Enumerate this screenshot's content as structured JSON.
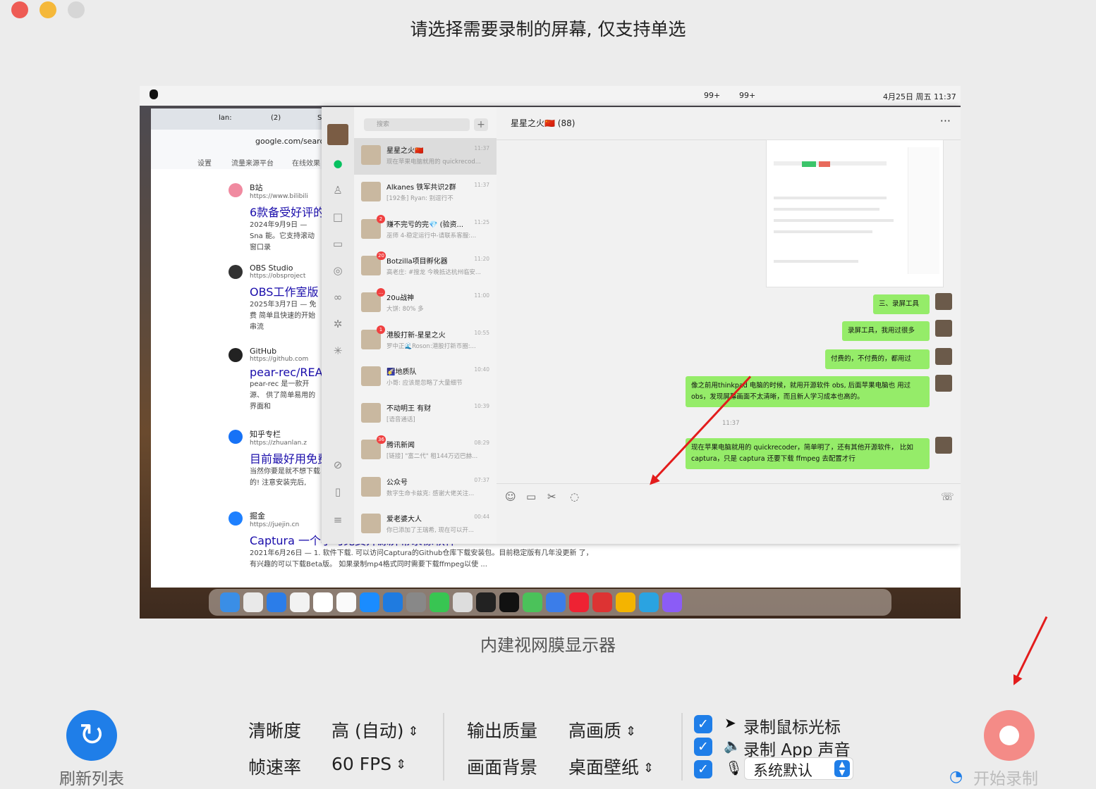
{
  "window": {
    "title": "请选择需要录制的屏幕, 仅支持单选",
    "close_color": "#ee5b54",
    "minimize_color": "#f5b83a",
    "zoom_color": "#d6d6d6"
  },
  "screen": {
    "name": "内建视网膜显示器",
    "menubar": {
      "datetime": "4月25日 周五 11:37",
      "wechat_badge_1": "99+",
      "wechat_badge_2": "99+"
    },
    "browser": {
      "tabs": [
        "lan:",
        "(2)",
        "S"
      ],
      "address": "google.com/search",
      "bookmarks": [
        "设置",
        "流量来源平台",
        "在线效果"
      ],
      "results": [
        {
          "site": "B站",
          "url": "https://www.bilibili",
          "title": "6款备受好评的",
          "snippet": "2024年9月9日 — Sna 能。它支持滚动窗口录"
        },
        {
          "site": "OBS Studio",
          "url": "https://obsproject",
          "title": "OBS工作室版",
          "snippet": "2025年3月7日 — 免费 简单且快速的开始串流"
        },
        {
          "site": "GitHub",
          "url": "https://github.com",
          "title": "pear-rec/READ",
          "snippet": "pear-rec 是一款开源、 供了简单易用的界面和"
        },
        {
          "site": "知乎专栏",
          "url": "https://zhuanlan.z",
          "title": "目前最好用免费",
          "snippet": "当然你要是就不想下载 的! 注意安装完后,"
        },
        {
          "site": "掘金",
          "url": "https://juejin.cn",
          "title": "Captura 一个小巧免费开源屏幕录像软件",
          "snippet": "2021年6月26日 — 1. 软件下载. 可以访问Captura的Github仓库下载安装包。目前稳定版有几年没更新 了，有兴趣的可以下载Beta版。 如果录制mp4格式同时需要下载ffmpeg以使 ..."
        }
      ]
    },
    "wechat": {
      "search_placeholder": "搜索",
      "chat_title": "星星之火🇨🇳 (88)",
      "conversations": [
        {
          "name": "星星之火🇨🇳",
          "preview": "现在苹果电脑就用的 quickrecod...",
          "time": "11:37",
          "badge": ""
        },
        {
          "name": "Alkanes 铁军共识2群",
          "preview": "[192条] Ryan: 别逗行不",
          "time": "11:37",
          "badge": ""
        },
        {
          "name": "赚不完亏的完💎 (验资...",
          "preview": "巫师 4-稳定运行中-请联系客服:...",
          "time": "11:25",
          "badge": "2"
        },
        {
          "name": "Botzilla项目孵化器",
          "preview": "高老庄: #搜龙 今晚抵达杭州临安...",
          "time": "11:20",
          "badge": "20"
        },
        {
          "name": "20u战神",
          "preview": "大饼: 80% 多",
          "time": "11:00",
          "badge": "..."
        },
        {
          "name": "港股打新-星星之火",
          "preview": "罗中正🌊Roson:港股打新币圈:...",
          "time": "10:55",
          "badge": "1"
        },
        {
          "name": "🌠地质队",
          "preview": "小哥: 应该是忽略了大量细节",
          "time": "10:40",
          "badge": ""
        },
        {
          "name": "不动明王 有财",
          "preview": "[语音通话]",
          "time": "10:39",
          "badge": ""
        },
        {
          "name": "腾讯新闻",
          "preview": "[链接] \"富二代\" 租144万迈巴赫...",
          "time": "08:29",
          "badge": "36"
        },
        {
          "name": "公众号",
          "preview": "数字生命卡兹克: 感谢大佬关注...",
          "time": "07:37",
          "badge": ""
        },
        {
          "name": "爱老婆大人",
          "preview": "你已添加了王瑞希, 现在可以开...",
          "time": "00:44",
          "badge": ""
        }
      ],
      "messages": [
        {
          "text": "三、录屏工具"
        },
        {
          "text": "录屏工具，我用过很多"
        },
        {
          "text": "付费的，不付费的，都用过"
        },
        {
          "text": "像之前用thinkpad 电脑的时候，就用开源软件 obs, 后面苹果电脑也 用过 obs，发现屏幕画面不太清晰，而且新人学习成本也高的。"
        },
        {
          "text": "现在苹果电脑就用的 quickrecoder，简单明了，还有其他开源软件， 比如 captura，只是 captura 还要下载 ffmpeg 去配置才行"
        }
      ],
      "timestamp": "11:37"
    }
  },
  "controls": {
    "refresh_label": "刷新列表",
    "resolution_label": "清晰度",
    "resolution_value": "高 (自动)",
    "fps_label": "帧速率",
    "fps_value": "60 FPS",
    "quality_label": "输出质量",
    "quality_value": "高画质",
    "background_label": "画面背景",
    "background_value": "桌面壁纸",
    "record_cursor_label": "录制鼠标光标",
    "record_cursor_checked": true,
    "record_app_audio_label": "录制 App 声音",
    "record_app_audio_checked": true,
    "mic_checked": true,
    "mic_value": "系统默认",
    "start_label": "开始录制",
    "accent": "#1f7ee8",
    "record_button_color": "#f48b87"
  }
}
